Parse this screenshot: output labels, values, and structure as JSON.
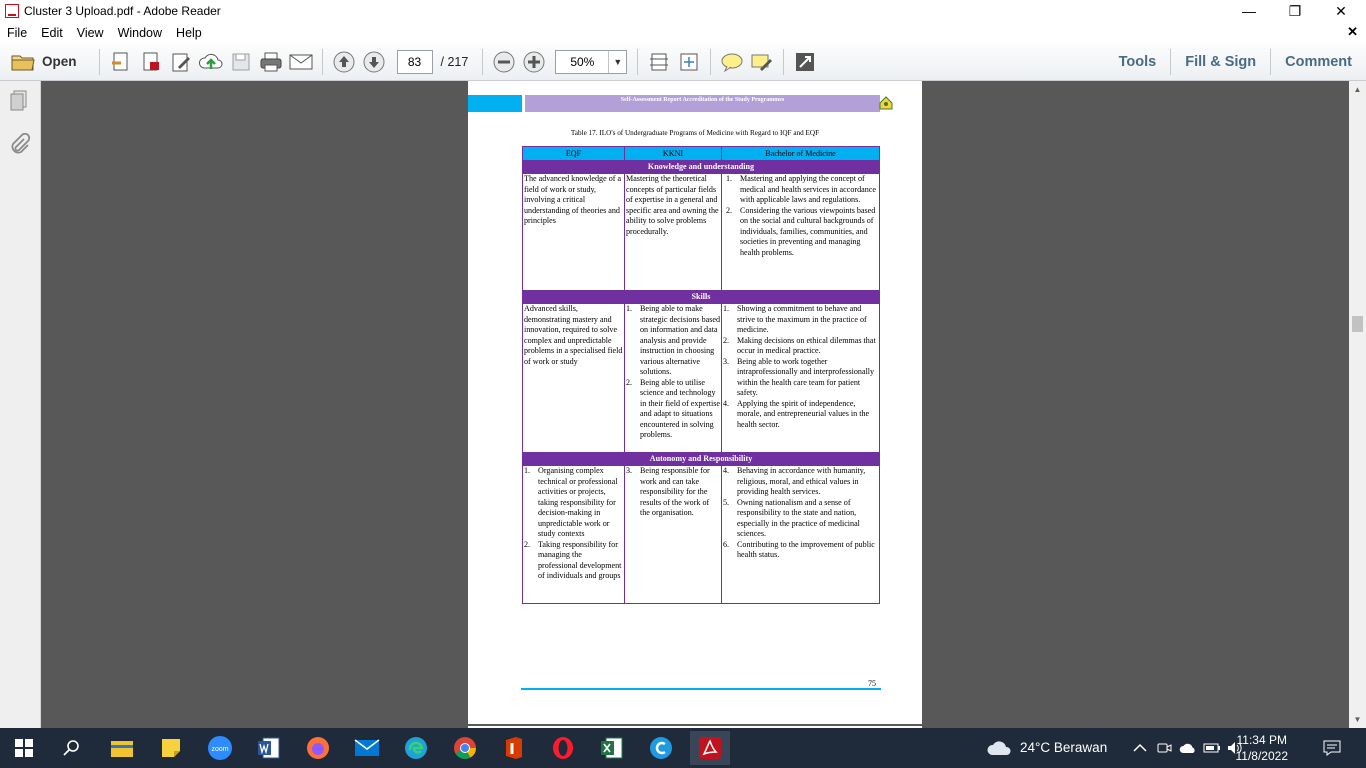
{
  "window": {
    "title": "Cluster 3 Upload.pdf - Adobe Reader",
    "minimize": "—",
    "restore": "❐",
    "close": "✕"
  },
  "menu": [
    "File",
    "Edit",
    "View",
    "Window",
    "Help"
  ],
  "menu_close": "✕",
  "toolbar": {
    "open_label": "Open",
    "page_current": "83",
    "page_total": "/ 217",
    "zoom": "50%",
    "tools": "Tools",
    "fill_sign": "Fill & Sign",
    "comment": "Comment"
  },
  "document": {
    "header_text": "Self-Assessment Report Accreditation of the Study Programmes",
    "caption": "Table 17. ILO's of Undergraduate Programs of Medicine with Regard to IQF and EQF",
    "columns": [
      "EQF",
      "KKNI",
      "Bachelor of Medicine"
    ],
    "sections": [
      {
        "title": "Knowledge and understanding",
        "eqf": "The advanced knowledge of a field of work or study, involving a critical understanding of theories and principles",
        "kkni": "Mastering the theoretical concepts of particular fields of expertise in a general and specific area and owning the ability to solve problems procedurally.",
        "bachelor": [
          {
            "n": "1.",
            "t": "Mastering and applying the concept of medical and health services in accordance with applicable laws and regulations."
          },
          {
            "n": "2.",
            "t": "Considering the various viewpoints based on the social and cultural backgrounds of individuals, families, communities, and societies in preventing and managing health problems."
          }
        ]
      },
      {
        "title": "Skills",
        "eqf": "Advanced skills, demonstrating mastery and innovation, required to solve complex and unpredictable problems in a specialised field of work or study",
        "kkni_list": [
          {
            "n": "1.",
            "t": "Being able to make strategic decisions based on information and data analysis and provide instruction in choosing various alternative solutions."
          },
          {
            "n": "2.",
            "t": "Being able to utilise science and technology in their field of expertise and adapt to situations encountered in solving problems."
          }
        ],
        "bachelor": [
          {
            "n": "1.",
            "t": "Showing a commitment to behave and strive to the maximum in the practice of medicine."
          },
          {
            "n": "2.",
            "t": "Making decisions on ethical dilemmas that occur in medical practice."
          },
          {
            "n": "3.",
            "t": "Being able to work together intraprofessionally and interprofessionally within the health care team for patient safety."
          },
          {
            "n": "4.",
            "t": "Applying the spirit of independence, morale, and entrepreneurial values in the health sector."
          }
        ]
      },
      {
        "title": "Autonomy and Responsibility",
        "eqf_list": [
          {
            "n": "1.",
            "t": "Organising complex technical or professional activities or projects, taking responsibility for decision-making in unpredictable work or study contexts"
          },
          {
            "n": "2.",
            "t": "Taking responsibility for managing the professional development of individuals and groups"
          }
        ],
        "kkni_list": [
          {
            "n": "3.",
            "t": "Being responsible for work and can take responsibility for the results of the work of the organisation."
          }
        ],
        "bachelor": [
          {
            "n": "4.",
            "t": "Behaving in accordance with humanity, religious, moral, and ethical values in providing health services."
          },
          {
            "n": "5.",
            "t": "Owning nationalism and a sense of responsibility to the state and nation, especially in the practice of medicinal sciences."
          },
          {
            "n": "6.",
            "t": "Contributing to the improvement of public health status."
          }
        ]
      }
    ],
    "page_number": "75"
  },
  "taskbar": {
    "weather": "24°C  Berawan",
    "time": "11:34 PM",
    "date": "11/8/2022",
    "zoom_label": "zoom",
    "apps": [
      "start",
      "search",
      "file-explorer",
      "sticky-notes",
      "zoom",
      "word",
      "firefox",
      "mail",
      "edge",
      "chrome",
      "office",
      "opera",
      "excel",
      "ccleaner",
      "adobe-reader"
    ]
  },
  "colors": {
    "purple": "#7030a0",
    "cyan": "#00b0f0",
    "doc_bg": "#585858",
    "taskbar": "#1f2a3a"
  }
}
